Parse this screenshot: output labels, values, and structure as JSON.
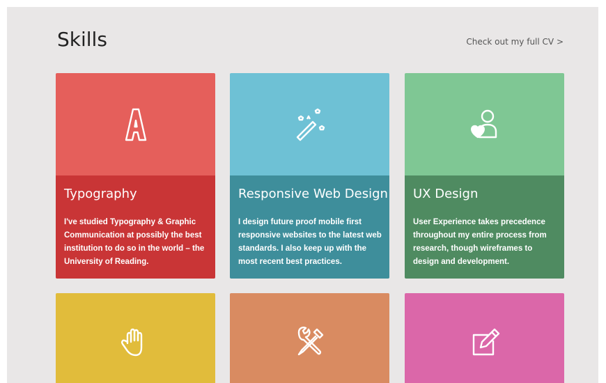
{
  "header": {
    "title": "Skills",
    "cv_link": "Check out my full CV >"
  },
  "cards": [
    {
      "title": "Typography",
      "icon": "letter-a-icon",
      "top_color": "#e55f5b",
      "bottom_color": "#c93536",
      "description": "I've studied Typography & Graphic Communication at possibly the best institution to do so in the world – the University of Reading."
    },
    {
      "title": "Responsive Web Design",
      "icon": "magic-wand-icon",
      "top_color": "#6ec1d5",
      "bottom_color": "#3e8e9b",
      "description": "I design future proof mobile first responsive websites to the latest web standards. I also keep up with the most recent best practices."
    },
    {
      "title": "UX Design",
      "icon": "user-heart-icon",
      "top_color": "#7fc794",
      "bottom_color": "#4f8b61",
      "description": "User Experience takes precedence throughout my entire process from research, though wireframes to design and development."
    },
    {
      "icon": "hand-icon",
      "top_color": "#e1bc3b"
    },
    {
      "icon": "tools-icon",
      "top_color": "#d98b61"
    },
    {
      "icon": "edit-icon",
      "top_color": "#db67a9"
    }
  ]
}
